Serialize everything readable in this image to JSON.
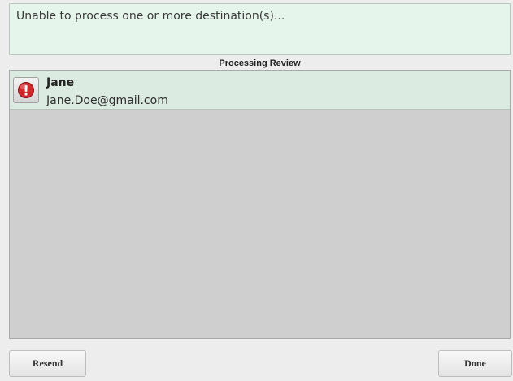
{
  "message": {
    "text": "Unable to process one or more destination(s)..."
  },
  "review": {
    "header": "Processing Review",
    "items": [
      {
        "name": "Jane",
        "email": "Jane.Doe@gmail.com",
        "status_icon": "error-icon"
      }
    ]
  },
  "buttons": {
    "resend_label": "Resend",
    "done_label": "Done"
  },
  "colors": {
    "message_bg": "#e6f5ec",
    "item_bg": "#dcebe2",
    "panel_bg": "#cfcfcf",
    "error_red": "#d0282b"
  }
}
